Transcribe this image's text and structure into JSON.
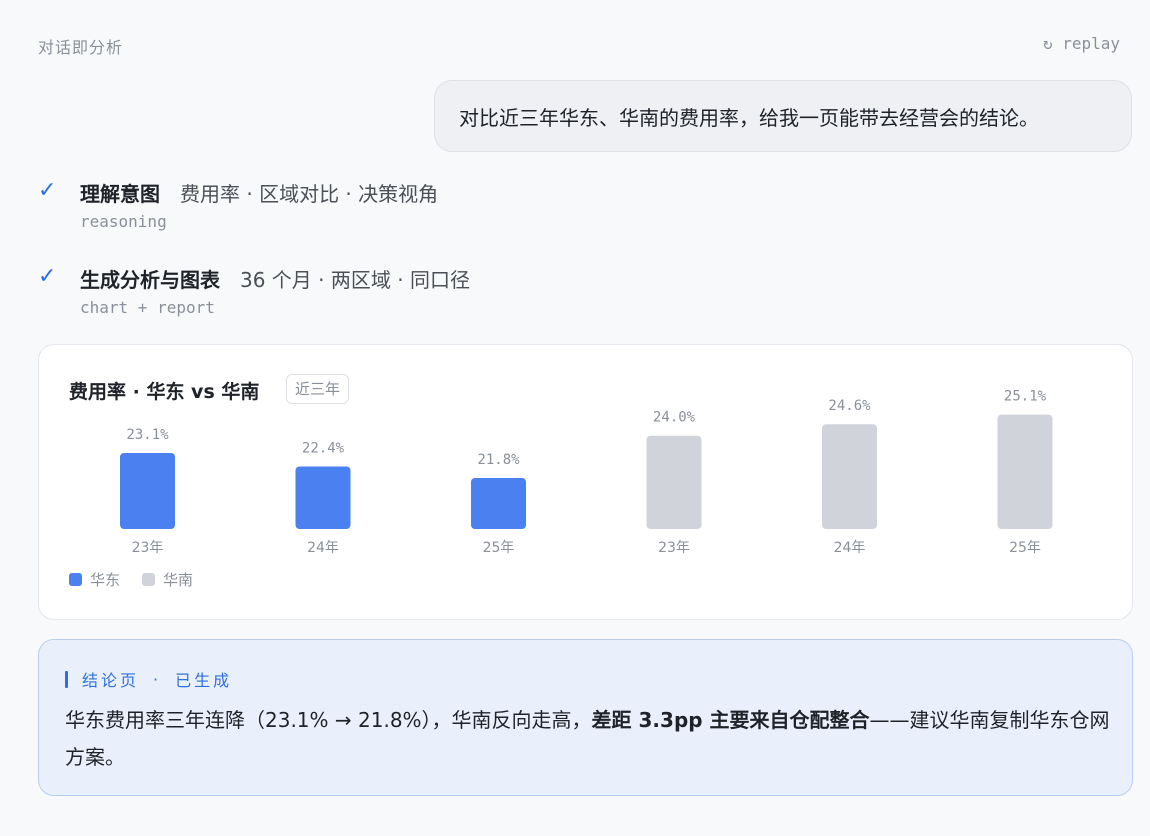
{
  "header": {
    "app_title": "对话即分析",
    "replay_label": "↻ replay"
  },
  "user_message": "对比近三年华东、华南的费用率，给我一页能带去经营会的结论。",
  "steps": [
    {
      "title": "理解意图",
      "tags": "费用率 · 区域对比 · 决策视角",
      "sub": "reasoning"
    },
    {
      "title": "生成分析与图表",
      "tags": "36 个月 · 两区域 · 同口径",
      "sub": "chart + report"
    }
  ],
  "chart": {
    "title": "费用率 · 华东 vs 华南",
    "badge": "近三年"
  },
  "chart_data": {
    "type": "bar",
    "series": [
      {
        "name": "华东",
        "color": "#4a80f0",
        "categories": [
          "23年",
          "24年",
          "25年"
        ],
        "values": [
          23.1,
          22.4,
          21.8
        ],
        "labels": [
          "23.1%",
          "22.4%",
          "21.8%"
        ]
      },
      {
        "name": "华南",
        "color": "#d0d3da",
        "categories": [
          "23年",
          "24年",
          "25年"
        ],
        "values": [
          24.0,
          24.6,
          25.1
        ],
        "labels": [
          "24.0%",
          "24.6%",
          "25.1%"
        ]
      }
    ],
    "legend_position": "bottom-left"
  },
  "conclusion": {
    "head_label": "结论页",
    "head_status": "已生成",
    "text_before": "华东费用率三年连降（23.1% → 21.8%），华南反向走高，",
    "text_bold": "差距 3.3pp 主要来自仓配整合",
    "text_after": "——建议华南复制华东仓网方案。"
  },
  "colors": {
    "accent": "#2f6fdd",
    "east": "#4a80f0",
    "south": "#d0d3da"
  }
}
